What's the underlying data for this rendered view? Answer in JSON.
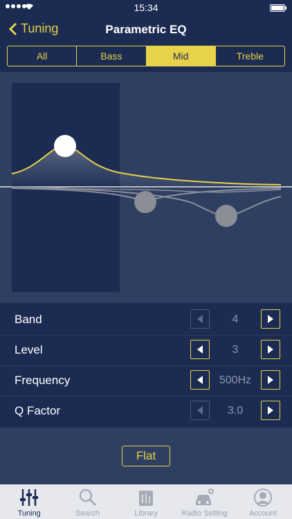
{
  "status_bar": {
    "time": "15:34"
  },
  "nav": {
    "back_label": "Tuning",
    "title": "Parametric EQ"
  },
  "segments": [
    {
      "label": "All",
      "active": false
    },
    {
      "label": "Bass",
      "active": false
    },
    {
      "label": "Mid",
      "active": true
    },
    {
      "label": "Treble",
      "active": false
    }
  ],
  "params": [
    {
      "label": "Band",
      "value": "4"
    },
    {
      "label": "Level",
      "value": "3"
    },
    {
      "label": "Frequency",
      "value": "500Hz"
    },
    {
      "label": "Q Factor",
      "value": "3.0"
    }
  ],
  "flat_label": "Flat",
  "tabs": [
    {
      "label": "Tuning",
      "icon": "sliders-icon",
      "active": true
    },
    {
      "label": "Search",
      "icon": "magnifier-icon",
      "active": false
    },
    {
      "label": "Library",
      "icon": "library-icon",
      "active": false
    },
    {
      "label": "Radio Setting",
      "icon": "car-radio-icon",
      "active": false
    },
    {
      "label": "Account",
      "icon": "user-icon",
      "active": false
    }
  ],
  "colors": {
    "accent": "#e8d24a",
    "background": "#1b2b52",
    "panel": "#2e3f62"
  }
}
